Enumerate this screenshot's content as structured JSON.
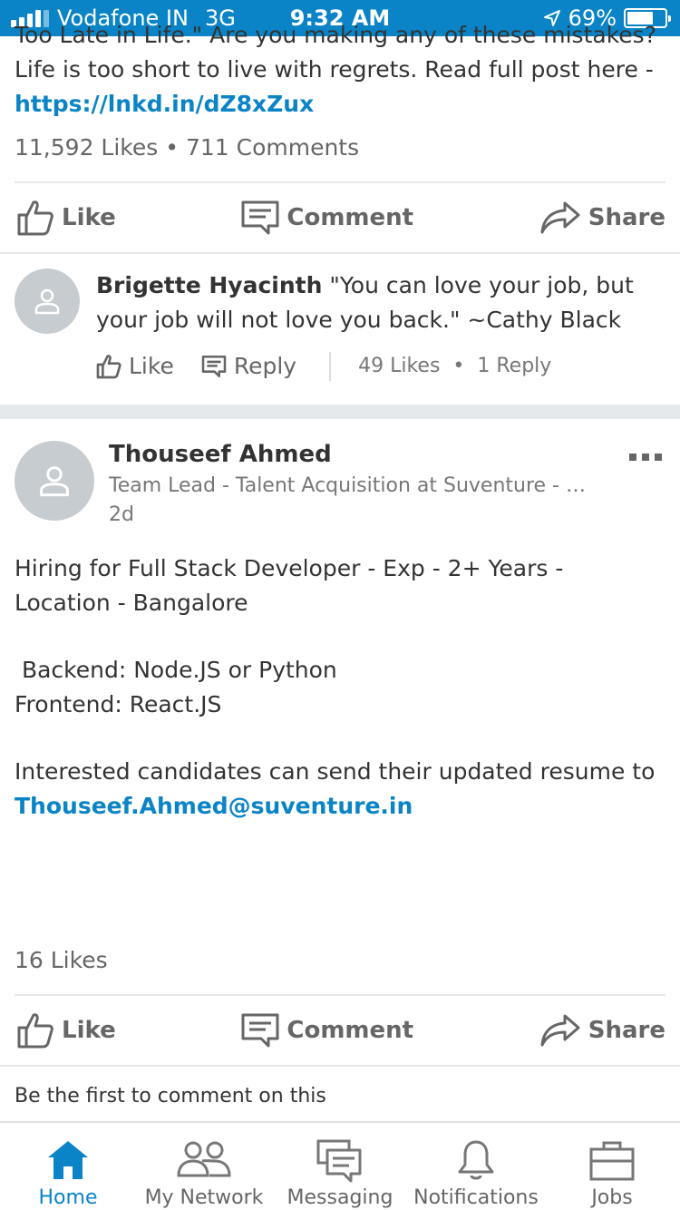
{
  "status_bar": {
    "carrier": "Vodafone IN",
    "network": "3G",
    "time": "9:32 AM",
    "battery": "69%",
    "battery_level": 0.69
  },
  "post1": {
    "text_partial": "Too Late in Life.\" Are you making any of these mistakes? Life is too short to live with regrets. Read full post here -",
    "link": "https://lnkd.in/dZ8xZux",
    "likes": "11,592 Likes",
    "comments": "711 Comments",
    "actions": {
      "like": "Like",
      "comment": "Comment",
      "share": "Share"
    },
    "top_comment": {
      "author": "Brigette Hyacinth",
      "text": "\"You can love your job, but your job will not love you back.\" ~Cathy Black",
      "like": "Like",
      "reply": "Reply",
      "likes": "49 Likes",
      "replies": "1 Reply"
    }
  },
  "post2": {
    "author": "Thouseef Ahmed",
    "headline": "Team Lead - Talent Acquisition at Suventure - C…",
    "time": "2d",
    "line1": "Hiring for Full Stack Developer - Exp - 2+ Years - Location - Bangalore",
    "line2": " Backend: Node.JS or Python",
    "line3": "Frontend: React.JS",
    "line4": "Interested candidates can send their updated resume to",
    "email": "Thouseef.Ahmed@suventure.in",
    "likes": "16 Likes",
    "actions": {
      "like": "Like",
      "comment": "Comment",
      "share": "Share"
    },
    "first_comment": "Be the first to comment on this"
  },
  "nav": {
    "items": [
      {
        "label": "Home",
        "icon": "home-icon",
        "active": true
      },
      {
        "label": "My Network",
        "icon": "network-icon"
      },
      {
        "label": "Messaging",
        "icon": "messaging-icon"
      },
      {
        "label": "Notifications",
        "icon": "bell-icon"
      },
      {
        "label": "Jobs",
        "icon": "briefcase-icon"
      }
    ]
  },
  "colors": {
    "accent": "#0a84c6",
    "text": "#333333",
    "muted": "#666666"
  }
}
